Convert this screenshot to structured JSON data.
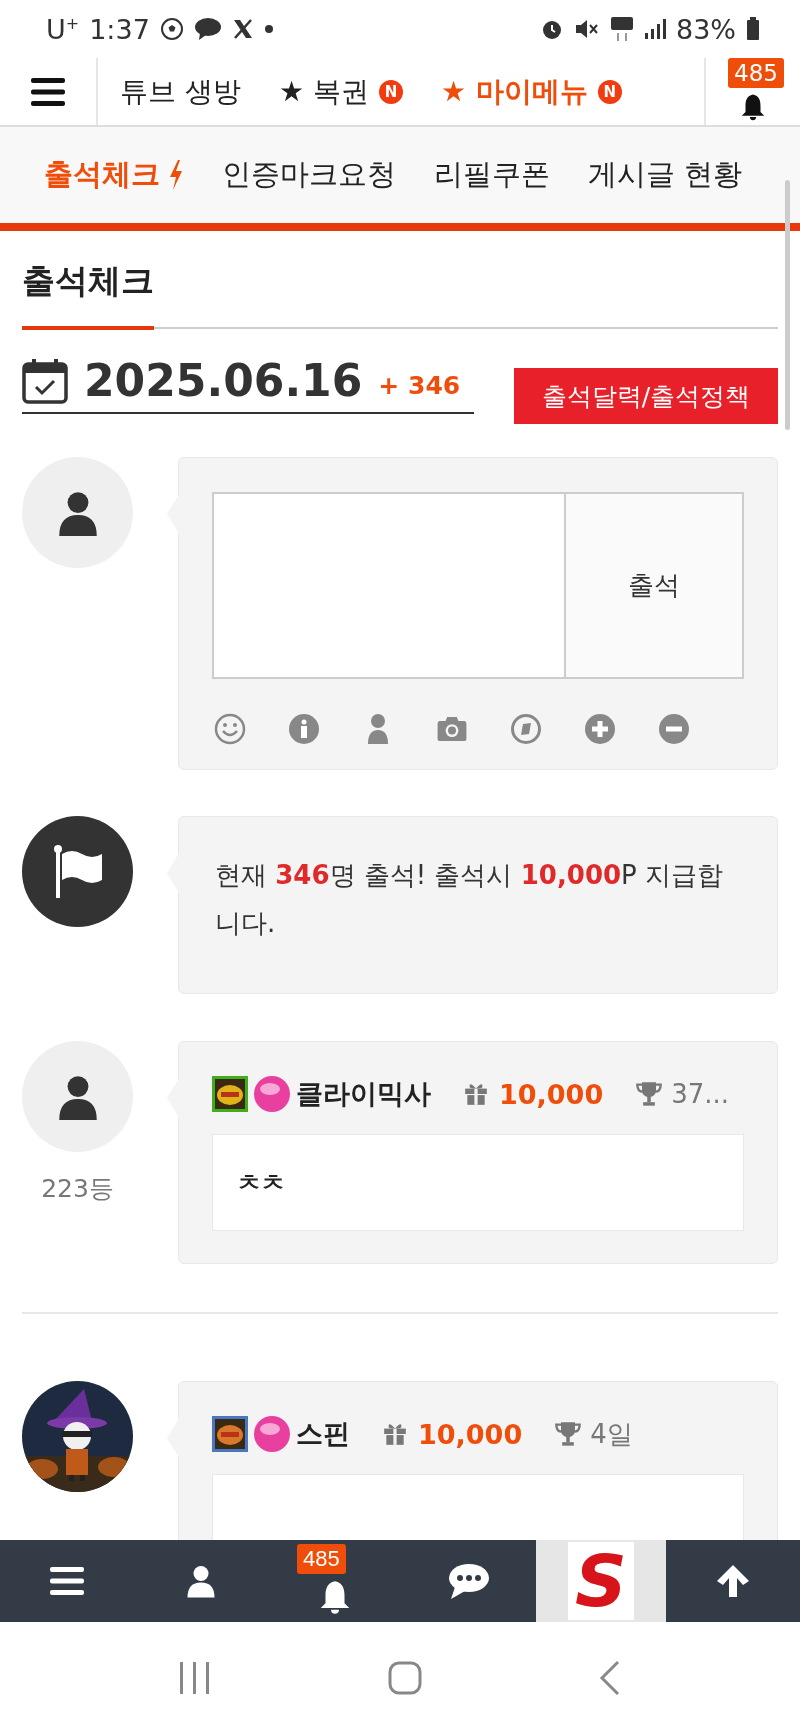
{
  "status_bar": {
    "carrier": "U$^{+}$",
    "time": "1:37",
    "battery": "83%"
  },
  "top_nav": {
    "items": [
      {
        "label": "튜브 생방",
        "highlighted": false
      },
      {
        "star": "★",
        "label": "복권",
        "badge": "N",
        "highlighted": false
      },
      {
        "star": "★",
        "label": "마이메뉴",
        "badge": "N",
        "highlighted": true
      }
    ],
    "notification_count": "485"
  },
  "sub_tabs": [
    {
      "label": "출석체크",
      "selected": true
    },
    {
      "label": "인증마크요청",
      "selected": false
    },
    {
      "label": "리필쿠폰",
      "selected": false
    },
    {
      "label": "게시글 현황",
      "selected": false
    }
  ],
  "section_title": "출석체크",
  "date": "2025.06.16",
  "attendance_count": "+ 346",
  "calendar_button": "출석달력/출석정책",
  "attendance_form": {
    "submit": "출석"
  },
  "notice": "현재 **346**명 출석! 출석시 **10,000**P 지급합니다.",
  "entries": [
    {
      "kind": "default",
      "rank": "223등",
      "name": "클라이믹사",
      "points": "10,000",
      "days": "37...",
      "comment": "ㅊㅊ"
    },
    {
      "kind": "picture",
      "name": "스핀",
      "points": "10,000",
      "days": "4일"
    }
  ],
  "bottom_bar": {
    "notification_count": "485",
    "logo": "S"
  }
}
